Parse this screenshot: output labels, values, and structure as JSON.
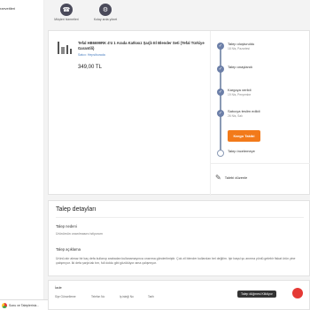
{
  "sidebar": {
    "link": "rzeveitleri"
  },
  "top_actions": [
    {
      "label": "Müşteri hizmetleri",
      "icon": "headset-icon"
    },
    {
      "label": "Kolay arda yönet",
      "icon": "settings-icon"
    }
  ],
  "order": {
    "product_title": "Tefal HB6699RK 4'ü 1 Arada Katkısız Şarjlı El Blender Seti (Tefal Türkiye Garantili)",
    "seller": "Satıcı: Hepsiburada",
    "price": "349,00 TL"
  },
  "timeline": [
    {
      "title": "Talep oluşturuldu",
      "date": "18 Nis, Pazartesi",
      "state": "done"
    },
    {
      "title": "Talep onaylandı",
      "date": "",
      "state": "done"
    },
    {
      "title": "Kargoya verildi",
      "date": "19 Nis, Perşembe",
      "state": "done"
    },
    {
      "title": "Satıcıya teslim edildi",
      "date": "26 Nis, Salı",
      "state": "done"
    },
    {
      "title": "Talep incelemeye",
      "date": "",
      "state": "pending"
    }
  ],
  "cargo_button": "Kargo Takibi",
  "edit_label": "Talebi düzenle",
  "details": {
    "title": "Talep detayları",
    "reason_label": "Talep nedeni",
    "reason_value": "Ürünümün onarılmasını istiyorum",
    "desc_label": "Talep açıklama",
    "desc_value": "Ürünü alır almaz bir kaç defa kullanıp arabadan kullanamayınca onarıma gönderilmiştir. Çok zil blender kullanılan bel değilim. Işir başsl şu anırma yönlü gelebir fiskat ürün yine çalışmıyor. İki defa şarja tak tım, full doldu gibi gözüküyor ama çalışmıyor."
  },
  "list": {
    "title": "İade",
    "headers": [
      "Sipr Güncelleme",
      "Telefon No",
      "Iş isteği No",
      "Tarih"
    ]
  },
  "taskbar": {
    "text": "Sonu ve Talepleriniz..."
  },
  "tooltip": "Talep düğmesi Kilidiyor"
}
